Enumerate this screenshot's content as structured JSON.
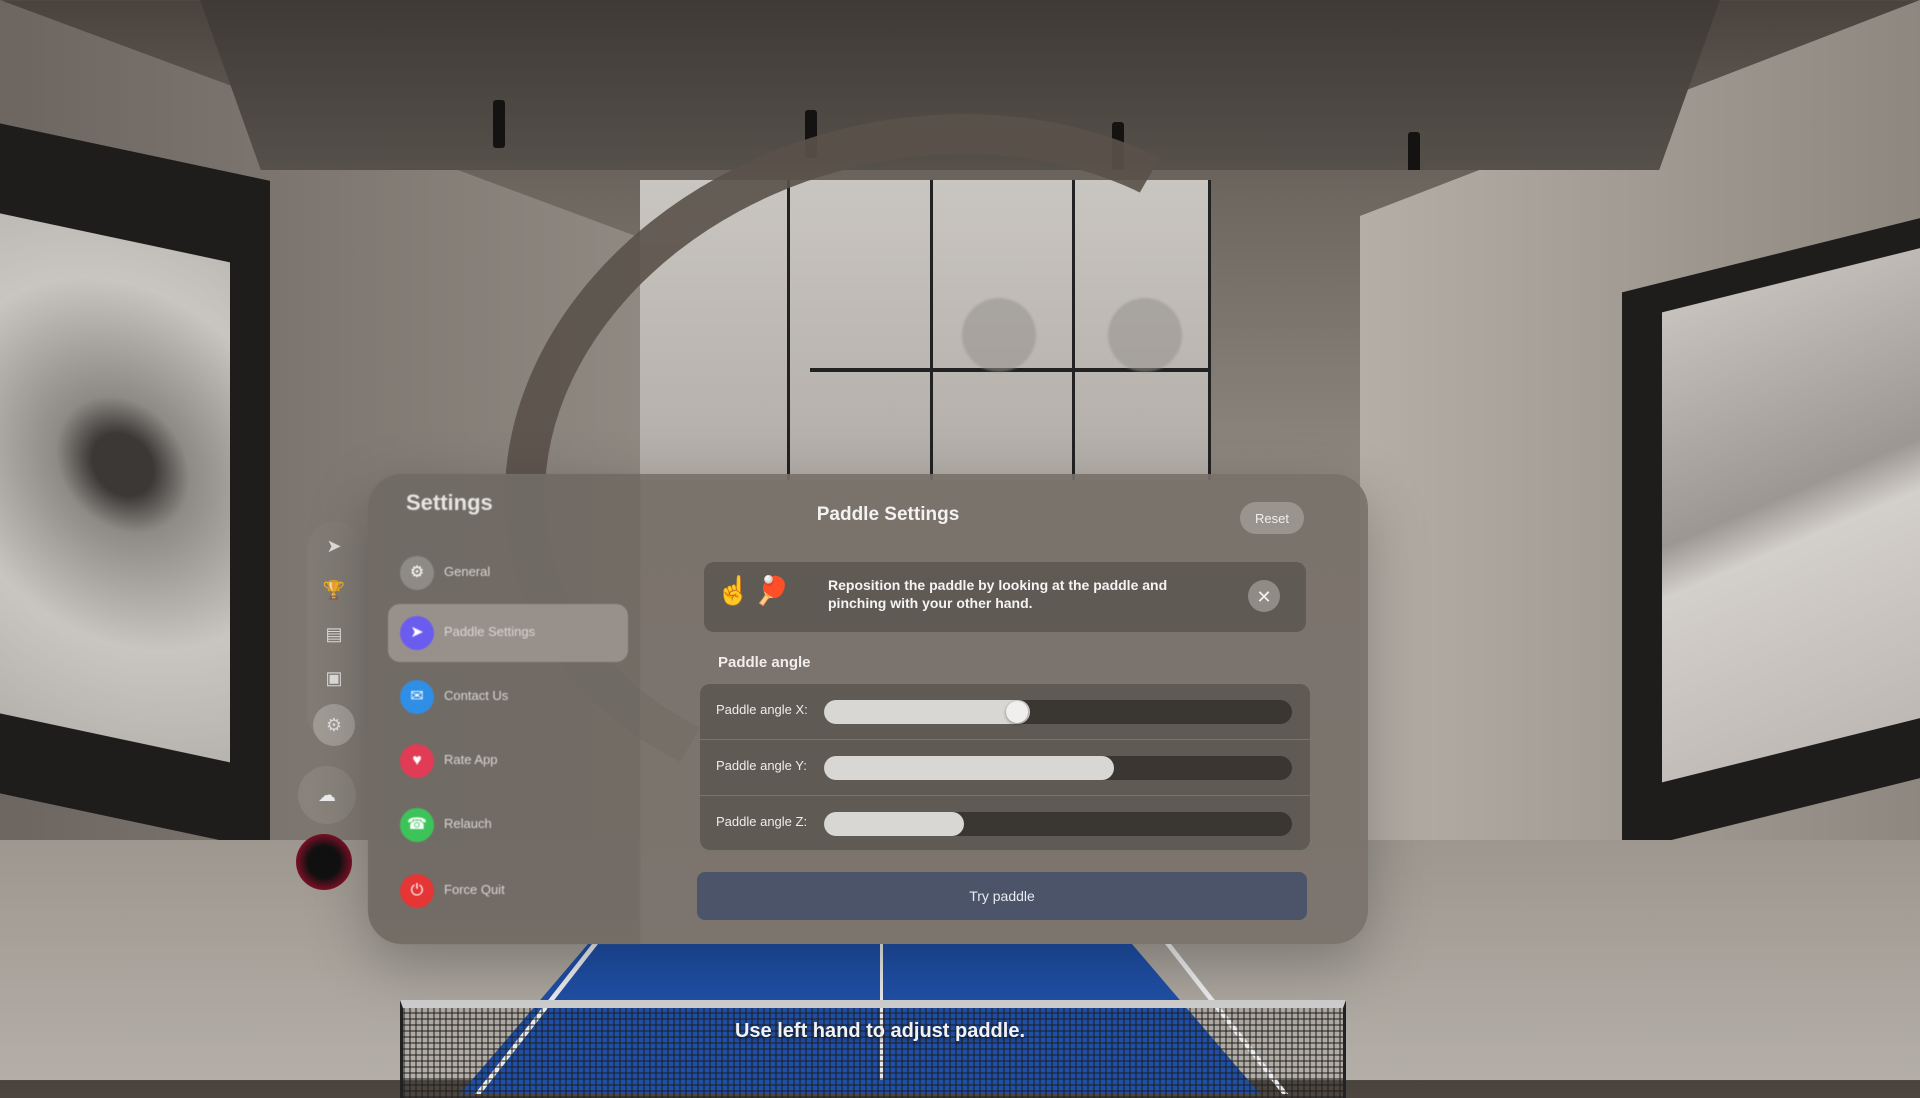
{
  "sidebar": {
    "title": "Settings",
    "items": [
      {
        "label": "General",
        "icon": "gear-icon",
        "color": "#8e8a86",
        "selected": false
      },
      {
        "label": "Paddle Settings",
        "icon": "paddle-icon",
        "color": "#6b5cf0",
        "selected": true
      },
      {
        "label": "Contact Us",
        "icon": "mail-icon",
        "color": "#2f8ee6",
        "selected": false
      },
      {
        "label": "Rate App",
        "icon": "heart-icon",
        "color": "#e23b55",
        "selected": false
      },
      {
        "label": "Relauch",
        "icon": "phone-icon",
        "color": "#3cc45a",
        "selected": false
      },
      {
        "label": "Force Quit",
        "icon": "power-icon",
        "color": "#e53535",
        "selected": false
      }
    ]
  },
  "rail": {
    "icons": [
      "paddle-icon",
      "trophy-icon",
      "table-icon",
      "bag-icon",
      "gear-icon"
    ],
    "selected": 4
  },
  "main": {
    "title": "Paddle Settings",
    "reset_label": "Reset",
    "banner": {
      "text": "Reposition the paddle by looking at the paddle and pinching with your other hand.",
      "icons": [
        "pinch-gesture-icon",
        "paddle-reposition-icon"
      ]
    },
    "section_label": "Paddle angle",
    "sliders": [
      {
        "label": "Paddle angle X:",
        "value": 0.44,
        "knob": true
      },
      {
        "label": "Paddle angle Y:",
        "value": 0.62,
        "knob": false
      },
      {
        "label": "Paddle angle Z:",
        "value": 0.3,
        "knob": false
      }
    ],
    "try_button_label": "Try paddle"
  },
  "hint": "Use left hand to adjust paddle."
}
